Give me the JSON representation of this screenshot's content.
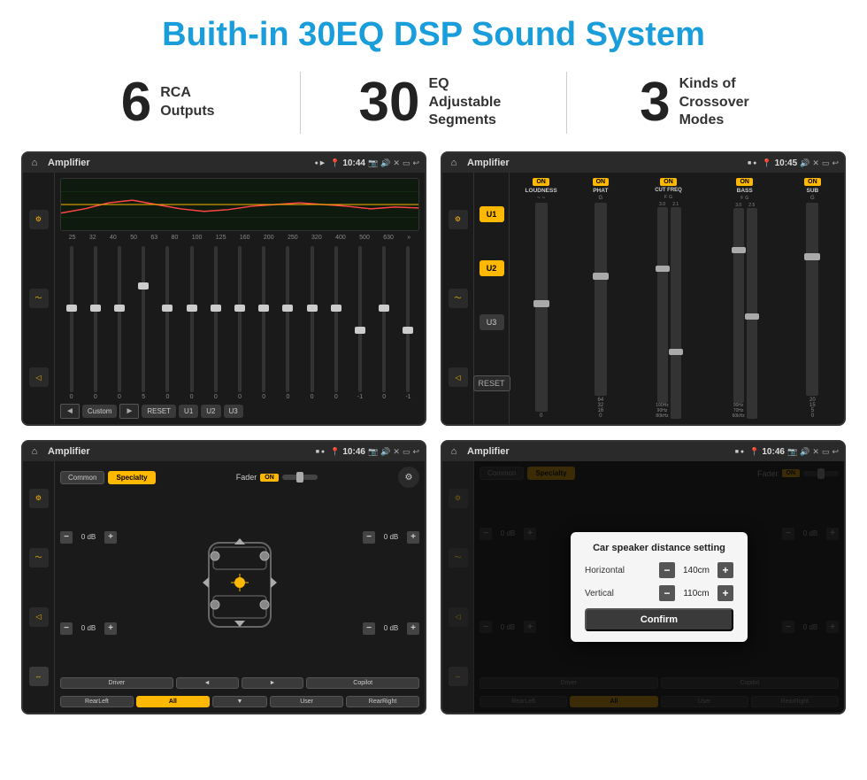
{
  "header": {
    "title": "Buith-in 30EQ DSP Sound System"
  },
  "stats": [
    {
      "number": "6",
      "label": "RCA\nOutputs"
    },
    {
      "number": "30",
      "label": "EQ Adjustable\nSegments"
    },
    {
      "number": "3",
      "label": "Kinds of\nCrossover Modes"
    }
  ],
  "screens": [
    {
      "id": "eq-screen",
      "statusBar": {
        "title": "Amplifier",
        "time": "10:44",
        "icons": "📍 📷 🔊 ✕ ▭ ↩"
      },
      "type": "eq"
    },
    {
      "id": "amp-screen",
      "statusBar": {
        "title": "Amplifier",
        "time": "10:45",
        "icons": "📍 🔊 ✕ ▭ ↩"
      },
      "type": "amp"
    },
    {
      "id": "fader-screen",
      "statusBar": {
        "title": "Amplifier",
        "time": "10:46",
        "icons": "📍 📷 🔊 ✕ ▭ ↩"
      },
      "type": "fader"
    },
    {
      "id": "dialog-screen",
      "statusBar": {
        "title": "Amplifier",
        "time": "10:46",
        "icons": "📍 📷 🔊 ✕ ▭ ↩"
      },
      "type": "dialog"
    }
  ],
  "eq": {
    "freqs": [
      "25",
      "32",
      "40",
      "50",
      "63",
      "80",
      "100",
      "125",
      "160",
      "200",
      "250",
      "320",
      "400",
      "500",
      "630"
    ],
    "values": [
      "0",
      "0",
      "0",
      "5",
      "0",
      "0",
      "0",
      "0",
      "0",
      "0",
      "0",
      "0",
      "-1",
      "0",
      "-1"
    ],
    "presets": [
      "Custom",
      "RESET",
      "U1",
      "U2",
      "U3"
    ]
  },
  "amp": {
    "presets": [
      "U1",
      "U2",
      "U3"
    ],
    "channels": [
      {
        "label": "LOUDNESS",
        "on": true
      },
      {
        "label": "PHAT",
        "on": true
      },
      {
        "label": "CUT FREQ",
        "on": true
      },
      {
        "label": "BASS",
        "on": true
      },
      {
        "label": "SUB",
        "on": true
      }
    ]
  },
  "fader": {
    "tabs": [
      "Common",
      "Specialty"
    ],
    "activeTab": "Specialty",
    "faderLabel": "Fader",
    "faderOn": true,
    "zones": [
      {
        "label": "0 dB"
      },
      {
        "label": "0 dB"
      },
      {
        "label": "0 dB"
      },
      {
        "label": "0 dB"
      }
    ],
    "buttons": [
      "Driver",
      "",
      "",
      "",
      "",
      "Copilot",
      "RearLeft",
      "All",
      "",
      "User",
      "RearRight"
    ]
  },
  "dialog": {
    "title": "Car speaker distance setting",
    "fields": [
      {
        "label": "Horizontal",
        "value": "140cm"
      },
      {
        "label": "Vertical",
        "value": "110cm"
      }
    ],
    "confirmLabel": "Confirm",
    "tabs": [
      "Common",
      "Specialty"
    ],
    "faderLabel": "Fader"
  },
  "colors": {
    "gold": "#ffb800",
    "blue": "#1a9edb",
    "dark": "#1a1a1a",
    "text": "#222222"
  }
}
